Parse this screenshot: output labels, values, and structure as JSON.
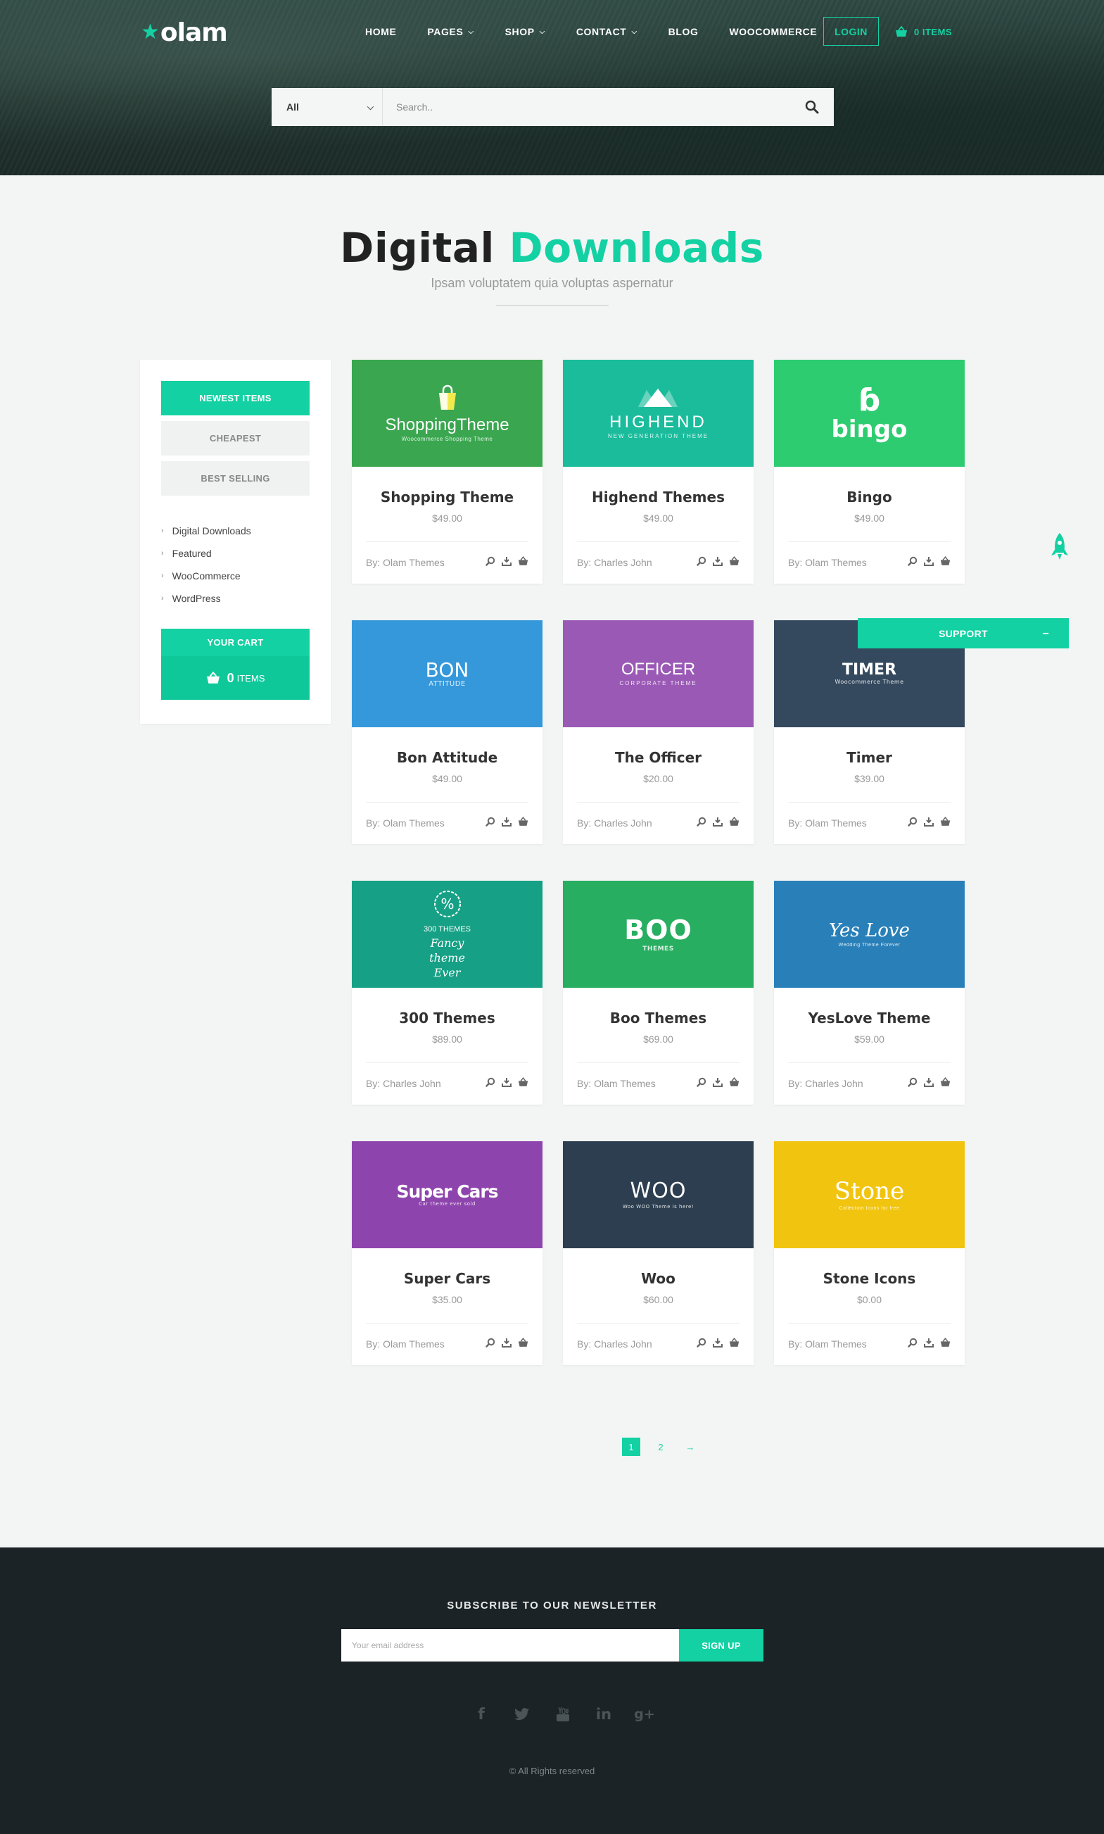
{
  "header": {
    "logo": "olam",
    "nav": [
      {
        "label": "HOME",
        "dropdown": false
      },
      {
        "label": "PAGES",
        "dropdown": true
      },
      {
        "label": "SHOP",
        "dropdown": true
      },
      {
        "label": "CONTACT",
        "dropdown": true
      },
      {
        "label": "BLOG",
        "dropdown": false
      },
      {
        "label": "WOOCOMMERCE",
        "dropdown": false
      }
    ],
    "login": "LOGIN",
    "cart": "0 ITEMS",
    "accent_color": "#13d1a3"
  },
  "search": {
    "category": "All",
    "placeholder": "Search.."
  },
  "page": {
    "title_main": "Digital",
    "title_accent": "Downloads",
    "subtitle": "Ipsam voluptatem quia voluptas aspernatur"
  },
  "sidebar": {
    "sort_buttons": [
      "NEWEST ITEMS",
      "CHEAPEST",
      "BEST SELLING"
    ],
    "active_sort": "NEWEST ITEMS",
    "categories": [
      "Digital Downloads",
      "Featured",
      "WooCommerce",
      "WordPress"
    ],
    "cart_title": "YOUR CART",
    "cart_count": "0",
    "cart_label": "ITEMS"
  },
  "products": [
    {
      "title": "Shopping Theme",
      "price": "$49.00",
      "author": "By: Olam Themes",
      "color": "#3aa64f",
      "logo": "ShoppingTheme",
      "logo_sub": "Woocommerce Shopping Theme"
    },
    {
      "title": "Highend Themes",
      "price": "$49.00",
      "author": "By: Charles John",
      "color": "#1abc9c",
      "logo": "HIGHEND",
      "logo_sub": "NEW GENERATION THEME"
    },
    {
      "title": "Bingo",
      "price": "$49.00",
      "author": "By: Olam Themes",
      "color": "#2ecc71",
      "logo": "bingo",
      "logo_sub": ""
    },
    {
      "title": "Bon Attitude",
      "price": "$49.00",
      "author": "By: Olam Themes",
      "color": "#3498db",
      "logo": "BON",
      "logo_sub": "ATTITUDE"
    },
    {
      "title": "The Officer",
      "price": "$20.00",
      "author": "By: Charles John",
      "color": "#9b59b6",
      "logo": "OFFICER",
      "logo_sub": "CORPORATE THEME"
    },
    {
      "title": "Timer",
      "price": "$39.00",
      "author": "By: Olam Themes",
      "color": "#34495e",
      "logo": "TIMER",
      "logo_sub": "Woocommerce Theme"
    },
    {
      "title": "300 Themes",
      "price": "$89.00",
      "author": "By: Charles John",
      "color": "#16a085",
      "logo": "300 THEMES",
      "logo_sub": "Fancy theme Ever"
    },
    {
      "title": "Boo Themes",
      "price": "$69.00",
      "author": "By: Olam Themes",
      "color": "#27ae60",
      "logo": "BOO",
      "logo_sub": "THEMES"
    },
    {
      "title": "YesLove Theme",
      "price": "$59.00",
      "author": "By: Charles John",
      "color": "#2980b9",
      "logo": "Yes Love",
      "logo_sub": "Wedding Theme Forever"
    },
    {
      "title": "Super Cars",
      "price": "$35.00",
      "author": "By: Olam Themes",
      "color": "#8e44ad",
      "logo": "Super Cars",
      "logo_sub": "Car theme ever sold"
    },
    {
      "title": "Woo",
      "price": "$60.00",
      "author": "By: Charles John",
      "color": "#2c3e50",
      "logo": "WOO",
      "logo_sub": "Woo WOO Theme is here!"
    },
    {
      "title": "Stone Icons",
      "price": "$0.00",
      "author": "By: Olam Themes",
      "color": "#f1c40f",
      "logo": "Stone",
      "logo_sub": "Collection Icons for free"
    }
  ],
  "pagination": {
    "pages": [
      "1",
      "2"
    ],
    "current": "1",
    "next": "→"
  },
  "support": {
    "label": "SUPPORT",
    "toggle": "–"
  },
  "footer": {
    "newsletter_title": "SUBSCRIBE TO OUR NEWSLETTER",
    "email_placeholder": "Your email address",
    "signup": "SIGN UP",
    "socials": [
      "facebook-icon",
      "twitter-icon",
      "youtube-icon",
      "linkedin-icon",
      "google-plus-icon"
    ],
    "copyright": "© All Rights reserved"
  }
}
